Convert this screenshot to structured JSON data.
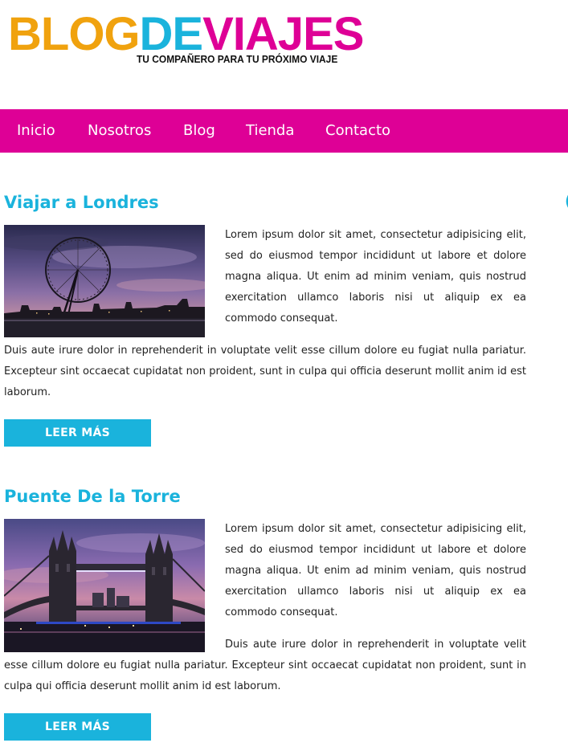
{
  "brand": {
    "logo_part1": "BLOG",
    "logo_part2": "DE",
    "logo_part3": "VIAJES",
    "tagline": "TU COMPAÑERO PARA TU PRÓXIMO VIAJE",
    "colors": {
      "blog": "#f0a20e",
      "de": "#1ab3dc",
      "viajes": "#de0096"
    }
  },
  "nav": {
    "items": [
      {
        "label": "Inicio"
      },
      {
        "label": "Nosotros"
      },
      {
        "label": "Blog"
      },
      {
        "label": "Tienda"
      },
      {
        "label": "Contacto"
      }
    ],
    "background": "#de0096"
  },
  "articles": [
    {
      "title": "Viajar a Londres",
      "image": "london-eye-photo",
      "paragraph1": "Lorem ipsum dolor sit amet, consectetur adipisicing elit, sed do eiusmod tempor incididunt ut labore et dolore magna aliqua. Ut enim ad minim veniam, quis nostrud exercitation ullamco laboris nisi ut aliquip ex ea commodo consequat.",
      "paragraph2": "Duis aute irure dolor in reprehenderit in voluptate velit esse cillum dolore eu fugiat nulla pariatur. Excepteur sint occaecat cupidatat non proident, sunt in culpa qui officia deserunt mollit anim id est laborum.",
      "button": "LEER MÁS"
    },
    {
      "title": "Puente De la Torre",
      "image": "tower-bridge-photo",
      "paragraph1": "Lorem ipsum dolor sit amet, consectetur adipisicing elit, sed do eiusmod tempor incididunt ut labore et dolore magna aliqua. Ut enim ad minim veniam, quis nostrud exercitation ullamco laboris nisi ut aliquip ex ea commodo consequat.",
      "paragraph2": "Duis aute irure dolor in reprehenderit in voluptate velit esse cillum dolore eu fugiat nulla pariatur. Excepteur sint occaecat cupidatat non proident, sunt in culpa qui officia deserunt mollit anim id est laborum.",
      "button": "LEER MÁS"
    }
  ],
  "accent_color": "#1ab3dc"
}
